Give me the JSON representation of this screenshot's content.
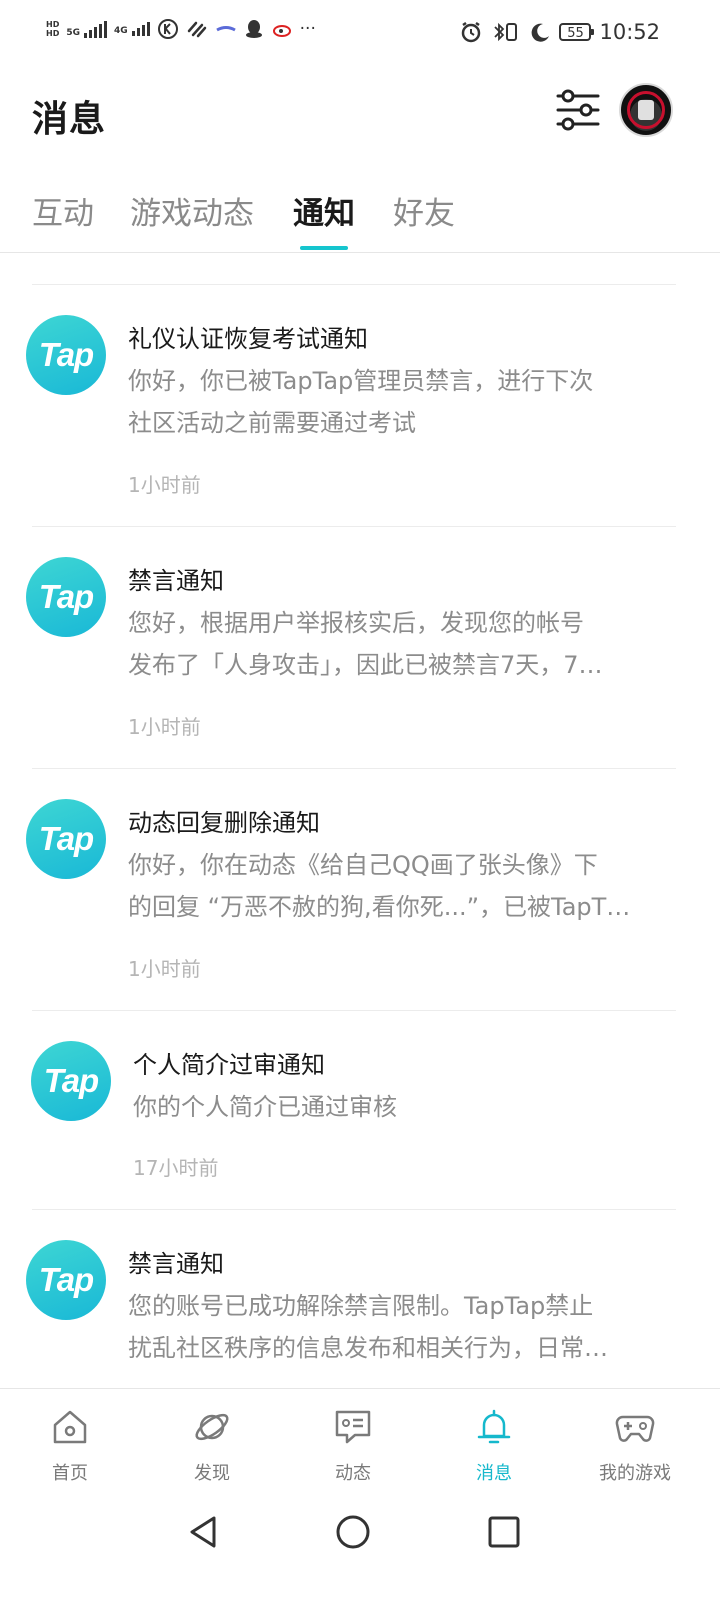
{
  "status_bar": {
    "hd1": "HD",
    "hd2": "HD",
    "net1": "5G",
    "net2": "4G",
    "more": "···",
    "battery": "55",
    "time": "10:52"
  },
  "header": {
    "title": "消息"
  },
  "tabs": [
    {
      "label": "互动"
    },
    {
      "label": "游戏动态"
    },
    {
      "label": "通知"
    },
    {
      "label": "好友"
    }
  ],
  "active_tab": "通知",
  "colors": {
    "accent": "#15c5ce",
    "logo_start": "#3ed6d4",
    "logo_end": "#19b8d6"
  },
  "notices": [
    {
      "logo": "Tap",
      "title": "礼仪认证恢复考试通知",
      "body_lines": [
        "你好，你已被TapTap管理员禁言，进行下次",
        "社区活动之前需要通过考试"
      ],
      "time": "1小时前"
    },
    {
      "logo": "Tap",
      "title": "禁言通知",
      "body_lines": [
        "您好，根据用户举报核实后，发现您的帐号",
        "发布了「人身攻击」，因此已被禁言7天，7…"
      ],
      "time": "1小时前"
    },
    {
      "logo": "Tap",
      "title": "动态回复删除通知",
      "body_lines": [
        "你好，你在动态《给自己QQ画了张头像》下",
        "的回复 “万恶不赦的狗,看你死...”，已被TapT…"
      ],
      "time": "1小时前"
    },
    {
      "logo": "Tap",
      "title": "个人简介过审通知",
      "body_lines": [
        "你的个人简介已通过审核"
      ],
      "time": "17小时前"
    },
    {
      "logo": "Tap",
      "title": "禁言通知",
      "body_lines": [
        "您的账号已成功解除禁言限制。TapTap禁止",
        "扰乱社区秩序的信息发布和相关行为，日常…"
      ],
      "time": ""
    }
  ],
  "bottom_nav": [
    {
      "label": "首页",
      "icon": "home-icon"
    },
    {
      "label": "发现",
      "icon": "planet-icon"
    },
    {
      "label": "动态",
      "icon": "feed-icon"
    },
    {
      "label": "消息",
      "icon": "bell-icon"
    },
    {
      "label": "我的游戏",
      "icon": "gamepad-icon"
    }
  ]
}
